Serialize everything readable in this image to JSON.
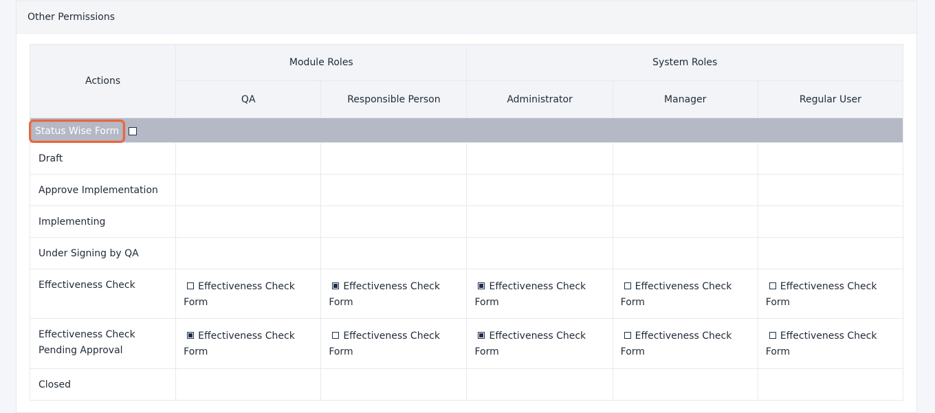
{
  "card": {
    "title": "Other Permissions"
  },
  "table": {
    "actions_header": "Actions",
    "group_headers": [
      "Module Roles",
      "System Roles"
    ],
    "role_headers": [
      "QA",
      "Responsible Person",
      "Administrator",
      "Manager",
      "Regular User"
    ],
    "group_row": {
      "label": "Status Wise Form",
      "checked": false
    },
    "rows": [
      {
        "action": "Draft",
        "cells": []
      },
      {
        "action": "Approve Implementation",
        "cells": []
      },
      {
        "action": "Implementing",
        "cells": []
      },
      {
        "action": "Under Signing by QA",
        "cells": []
      },
      {
        "action": "Effectiveness Check",
        "cells": [
          {
            "label": "Effectiveness Check Form",
            "checked": false
          },
          {
            "label": "Effectiveness Check Form",
            "checked": true
          },
          {
            "label": "Effectiveness Check Form",
            "checked": true
          },
          {
            "label": "Effectiveness Check Form",
            "checked": false
          },
          {
            "label": "Effectiveness Check Form",
            "checked": false
          }
        ]
      },
      {
        "action": "Effectiveness Check Pending Approval",
        "cells": [
          {
            "label": "Effectiveness Check Form",
            "checked": true
          },
          {
            "label": "Effectiveness Check Form",
            "checked": false
          },
          {
            "label": "Effectiveness Check Form",
            "checked": true
          },
          {
            "label": "Effectiveness Check Form",
            "checked": false
          },
          {
            "label": "Effectiveness Check Form",
            "checked": false
          }
        ]
      },
      {
        "action": "Closed",
        "cells": []
      }
    ]
  },
  "colors": {
    "group_row_bg": "#b5b8c5",
    "highlight": "#e9673f",
    "checkbox": "#1f2d4a"
  }
}
